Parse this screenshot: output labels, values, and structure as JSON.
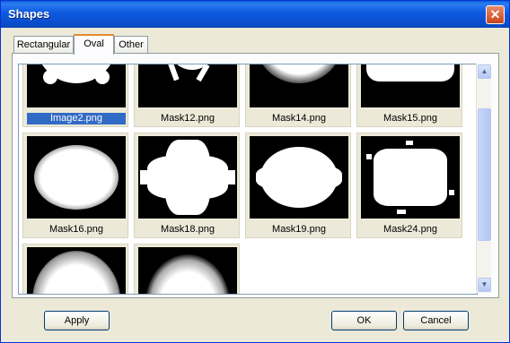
{
  "window": {
    "title": "Shapes",
    "close_glyph": "✕"
  },
  "tabs": [
    {
      "label": "Rectangular"
    },
    {
      "label": "Oval"
    },
    {
      "label": "Other"
    }
  ],
  "gallery": {
    "items": [
      {
        "label": "Image2.png",
        "selected": true
      },
      {
        "label": "Mask12.png"
      },
      {
        "label": "Mask14.png"
      },
      {
        "label": "Mask15.png"
      },
      {
        "label": "Mask16.png"
      },
      {
        "label": "Mask18.png"
      },
      {
        "label": "Mask19.png"
      },
      {
        "label": "Mask24.png"
      },
      {
        "label": ""
      },
      {
        "label": ""
      }
    ]
  },
  "scrollbar": {
    "up_glyph": "▲",
    "down_glyph": "▼"
  },
  "buttons": {
    "apply": "Apply",
    "ok": "OK",
    "cancel": "Cancel"
  }
}
